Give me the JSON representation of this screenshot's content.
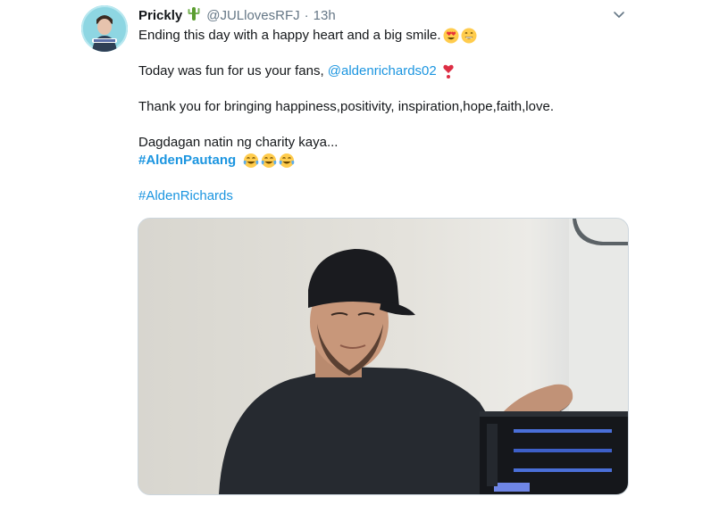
{
  "tweet": {
    "display_name": "Prickly",
    "name_emoji": "cactus-emoji",
    "handle": "@JULlovesRFJ",
    "separator": "·",
    "time": "13h",
    "lines": {
      "l1": "Ending this day with a happy heart and a big smile.",
      "l2_prefix": "Today was fun for us your fans, ",
      "l2_mention": "@aldenrichards02",
      "l3": "Thank you for bringing happiness,positivity, inspiration,hope,faith,love.",
      "l4": "Dagdagan natin ng charity kaya...",
      "l5_hashtag": "#AldenPautang",
      "l6_hashtag": "#AldenRichards"
    },
    "emojis": {
      "l1": [
        "heart-eyes-emoji",
        "grinning-emoji"
      ],
      "l2": [
        "heart-exclamation-emoji"
      ],
      "l5": [
        "tears-of-joy-emoji",
        "tears-of-joy-emoji",
        "tears-of-joy-emoji"
      ]
    },
    "colors": {
      "link": "#1b95e0",
      "secondary_text": "#657786",
      "primary_text": "#14171a",
      "border": "#ccd6dd"
    }
  }
}
